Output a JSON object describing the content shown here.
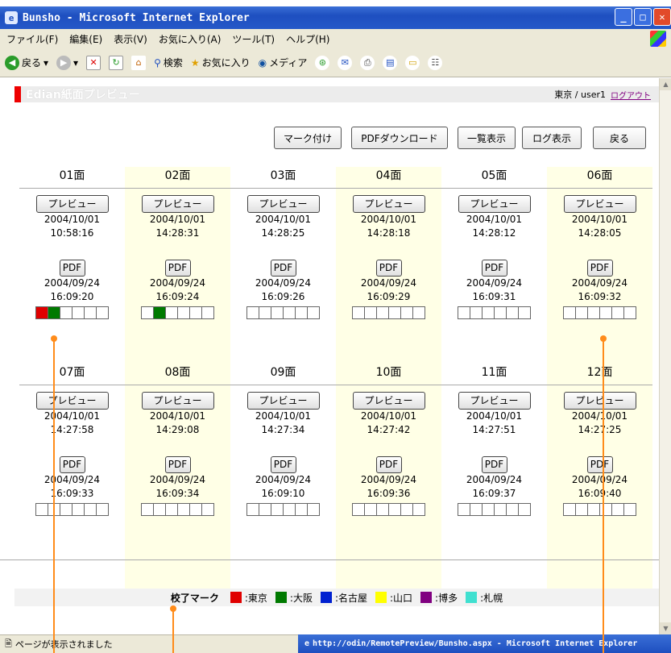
{
  "window": {
    "title": "Bunsho - Microsoft Internet Explorer"
  },
  "menu": [
    "ファイル(F)",
    "編集(E)",
    "表示(V)",
    "お気に入り(A)",
    "ツール(T)",
    "ヘルプ(H)"
  ],
  "toolbar": {
    "back": "戻る",
    "search": "検索",
    "favorites": "お気に入り",
    "media": "メディア"
  },
  "header": {
    "title": "Edian紙面プレビュー",
    "user": "東京 / user1",
    "logout": "ログアウト"
  },
  "actions": {
    "mark": "マーク付け",
    "pdf_download": "PDFダウンロード",
    "list": "一覧表示",
    "log": "ログ表示",
    "back": "戻る"
  },
  "labels": {
    "preview": "プレビュー",
    "pdf": "PDF"
  },
  "pages": [
    {
      "name": "01面",
      "pv_date": "2004/10/01",
      "pv_time": "10:58:16",
      "pdf_date": "2004/09/24",
      "pdf_time": "16:09:20",
      "marks": [
        "#e00000",
        "#007a00",
        "",
        "",
        "",
        ""
      ]
    },
    {
      "name": "02面",
      "pv_date": "2004/10/01",
      "pv_time": "14:28:31",
      "pdf_date": "2004/09/24",
      "pdf_time": "16:09:24",
      "marks": [
        "",
        "#007a00",
        "",
        "",
        "",
        ""
      ]
    },
    {
      "name": "03面",
      "pv_date": "2004/10/01",
      "pv_time": "14:28:25",
      "pdf_date": "2004/09/24",
      "pdf_time": "16:09:26",
      "marks": [
        "",
        "",
        "",
        "",
        "",
        ""
      ]
    },
    {
      "name": "04面",
      "pv_date": "2004/10/01",
      "pv_time": "14:28:18",
      "pdf_date": "2004/09/24",
      "pdf_time": "16:09:29",
      "marks": [
        "",
        "",
        "",
        "",
        "",
        ""
      ]
    },
    {
      "name": "05面",
      "pv_date": "2004/10/01",
      "pv_time": "14:28:12",
      "pdf_date": "2004/09/24",
      "pdf_time": "16:09:31",
      "marks": [
        "",
        "",
        "",
        "",
        "",
        ""
      ]
    },
    {
      "name": "06面",
      "pv_date": "2004/10/01",
      "pv_time": "14:28:05",
      "pdf_date": "2004/09/24",
      "pdf_time": "16:09:32",
      "marks": [
        "",
        "",
        "",
        "",
        "",
        ""
      ]
    },
    {
      "name": "07面",
      "pv_date": "2004/10/01",
      "pv_time": "14:27:58",
      "pdf_date": "2004/09/24",
      "pdf_time": "16:09:33",
      "marks": [
        "",
        "",
        "",
        "",
        "",
        ""
      ]
    },
    {
      "name": "08面",
      "pv_date": "2004/10/01",
      "pv_time": "14:29:08",
      "pdf_date": "2004/09/24",
      "pdf_time": "16:09:34",
      "marks": [
        "",
        "",
        "",
        "",
        "",
        ""
      ]
    },
    {
      "name": "09面",
      "pv_date": "2004/10/01",
      "pv_time": "14:27:34",
      "pdf_date": "2004/09/24",
      "pdf_time": "16:09:10",
      "marks": [
        "",
        "",
        "",
        "",
        "",
        ""
      ]
    },
    {
      "name": "10面",
      "pv_date": "2004/10/01",
      "pv_time": "14:27:42",
      "pdf_date": "2004/09/24",
      "pdf_time": "16:09:36",
      "marks": [
        "",
        "",
        "",
        "",
        "",
        ""
      ]
    },
    {
      "name": "11面",
      "pv_date": "2004/10/01",
      "pv_time": "14:27:51",
      "pdf_date": "2004/09/24",
      "pdf_time": "16:09:37",
      "marks": [
        "",
        "",
        "",
        "",
        "",
        ""
      ]
    },
    {
      "name": "12面",
      "pv_date": "2004/10/01",
      "pv_time": "14:27:25",
      "pdf_date": "2004/09/24",
      "pdf_time": "16:09:40",
      "marks": [
        "",
        "",
        "",
        "",
        "",
        ""
      ]
    }
  ],
  "legend": {
    "title": "校了マーク",
    "items": [
      {
        "label": ":東京",
        "color": "#e00000"
      },
      {
        "label": ":大阪",
        "color": "#007a00"
      },
      {
        "label": ":名古屋",
        "color": "#0020d0"
      },
      {
        "label": ":山口",
        "color": "#ffff00"
      },
      {
        "label": ":博多",
        "color": "#800080"
      },
      {
        "label": ":札幌",
        "color": "#40e0d0"
      }
    ]
  },
  "status": {
    "text": "ページが表示されました",
    "task": "http://odin/RemotePreview/Bunsho.aspx - Microsoft Internet Explorer"
  }
}
